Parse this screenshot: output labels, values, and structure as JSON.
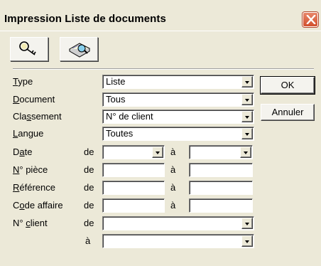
{
  "window": {
    "title": "Impression Liste de documents"
  },
  "toolbar": {
    "buttons": [
      {
        "icon": "search-key-icon"
      },
      {
        "icon": "print-preview-icon"
      }
    ]
  },
  "form": {
    "type": {
      "label_pre": "",
      "label_ul": "T",
      "label_post": "ype",
      "value": "Liste"
    },
    "document": {
      "label_pre": "",
      "label_ul": "D",
      "label_post": "ocument",
      "value": "Tous"
    },
    "classement": {
      "label_pre": "Cla",
      "label_ul": "s",
      "label_post": "sement",
      "value": "N° de client"
    },
    "langue": {
      "label_pre": "",
      "label_ul": "L",
      "label_post": "angue",
      "value": "Toutes"
    },
    "date": {
      "label_pre": "D",
      "label_ul": "a",
      "label_post": "te",
      "from_prep": "de",
      "to_prep": "à",
      "from": "",
      "to": ""
    },
    "numero_piece": {
      "label_pre": "",
      "label_ul": "N",
      "label_post": "° pièce",
      "from_prep": "de",
      "to_prep": "à",
      "from": "",
      "to": ""
    },
    "reference": {
      "label_pre": "",
      "label_ul": "R",
      "label_post": "éférence",
      "from_prep": "de",
      "to_prep": "à",
      "from": "",
      "to": ""
    },
    "code_affaire": {
      "label_pre": "C",
      "label_ul": "o",
      "label_post": "de affaire",
      "from_prep": "de",
      "to_prep": "à",
      "from": "",
      "to": ""
    },
    "numero_client": {
      "label_pre": "N° ",
      "label_ul": "c",
      "label_post": "lient",
      "from_prep": "de",
      "to_prep": "à",
      "from": "",
      "to": ""
    }
  },
  "buttons": {
    "ok": "OK",
    "annuler": "Annuler"
  }
}
